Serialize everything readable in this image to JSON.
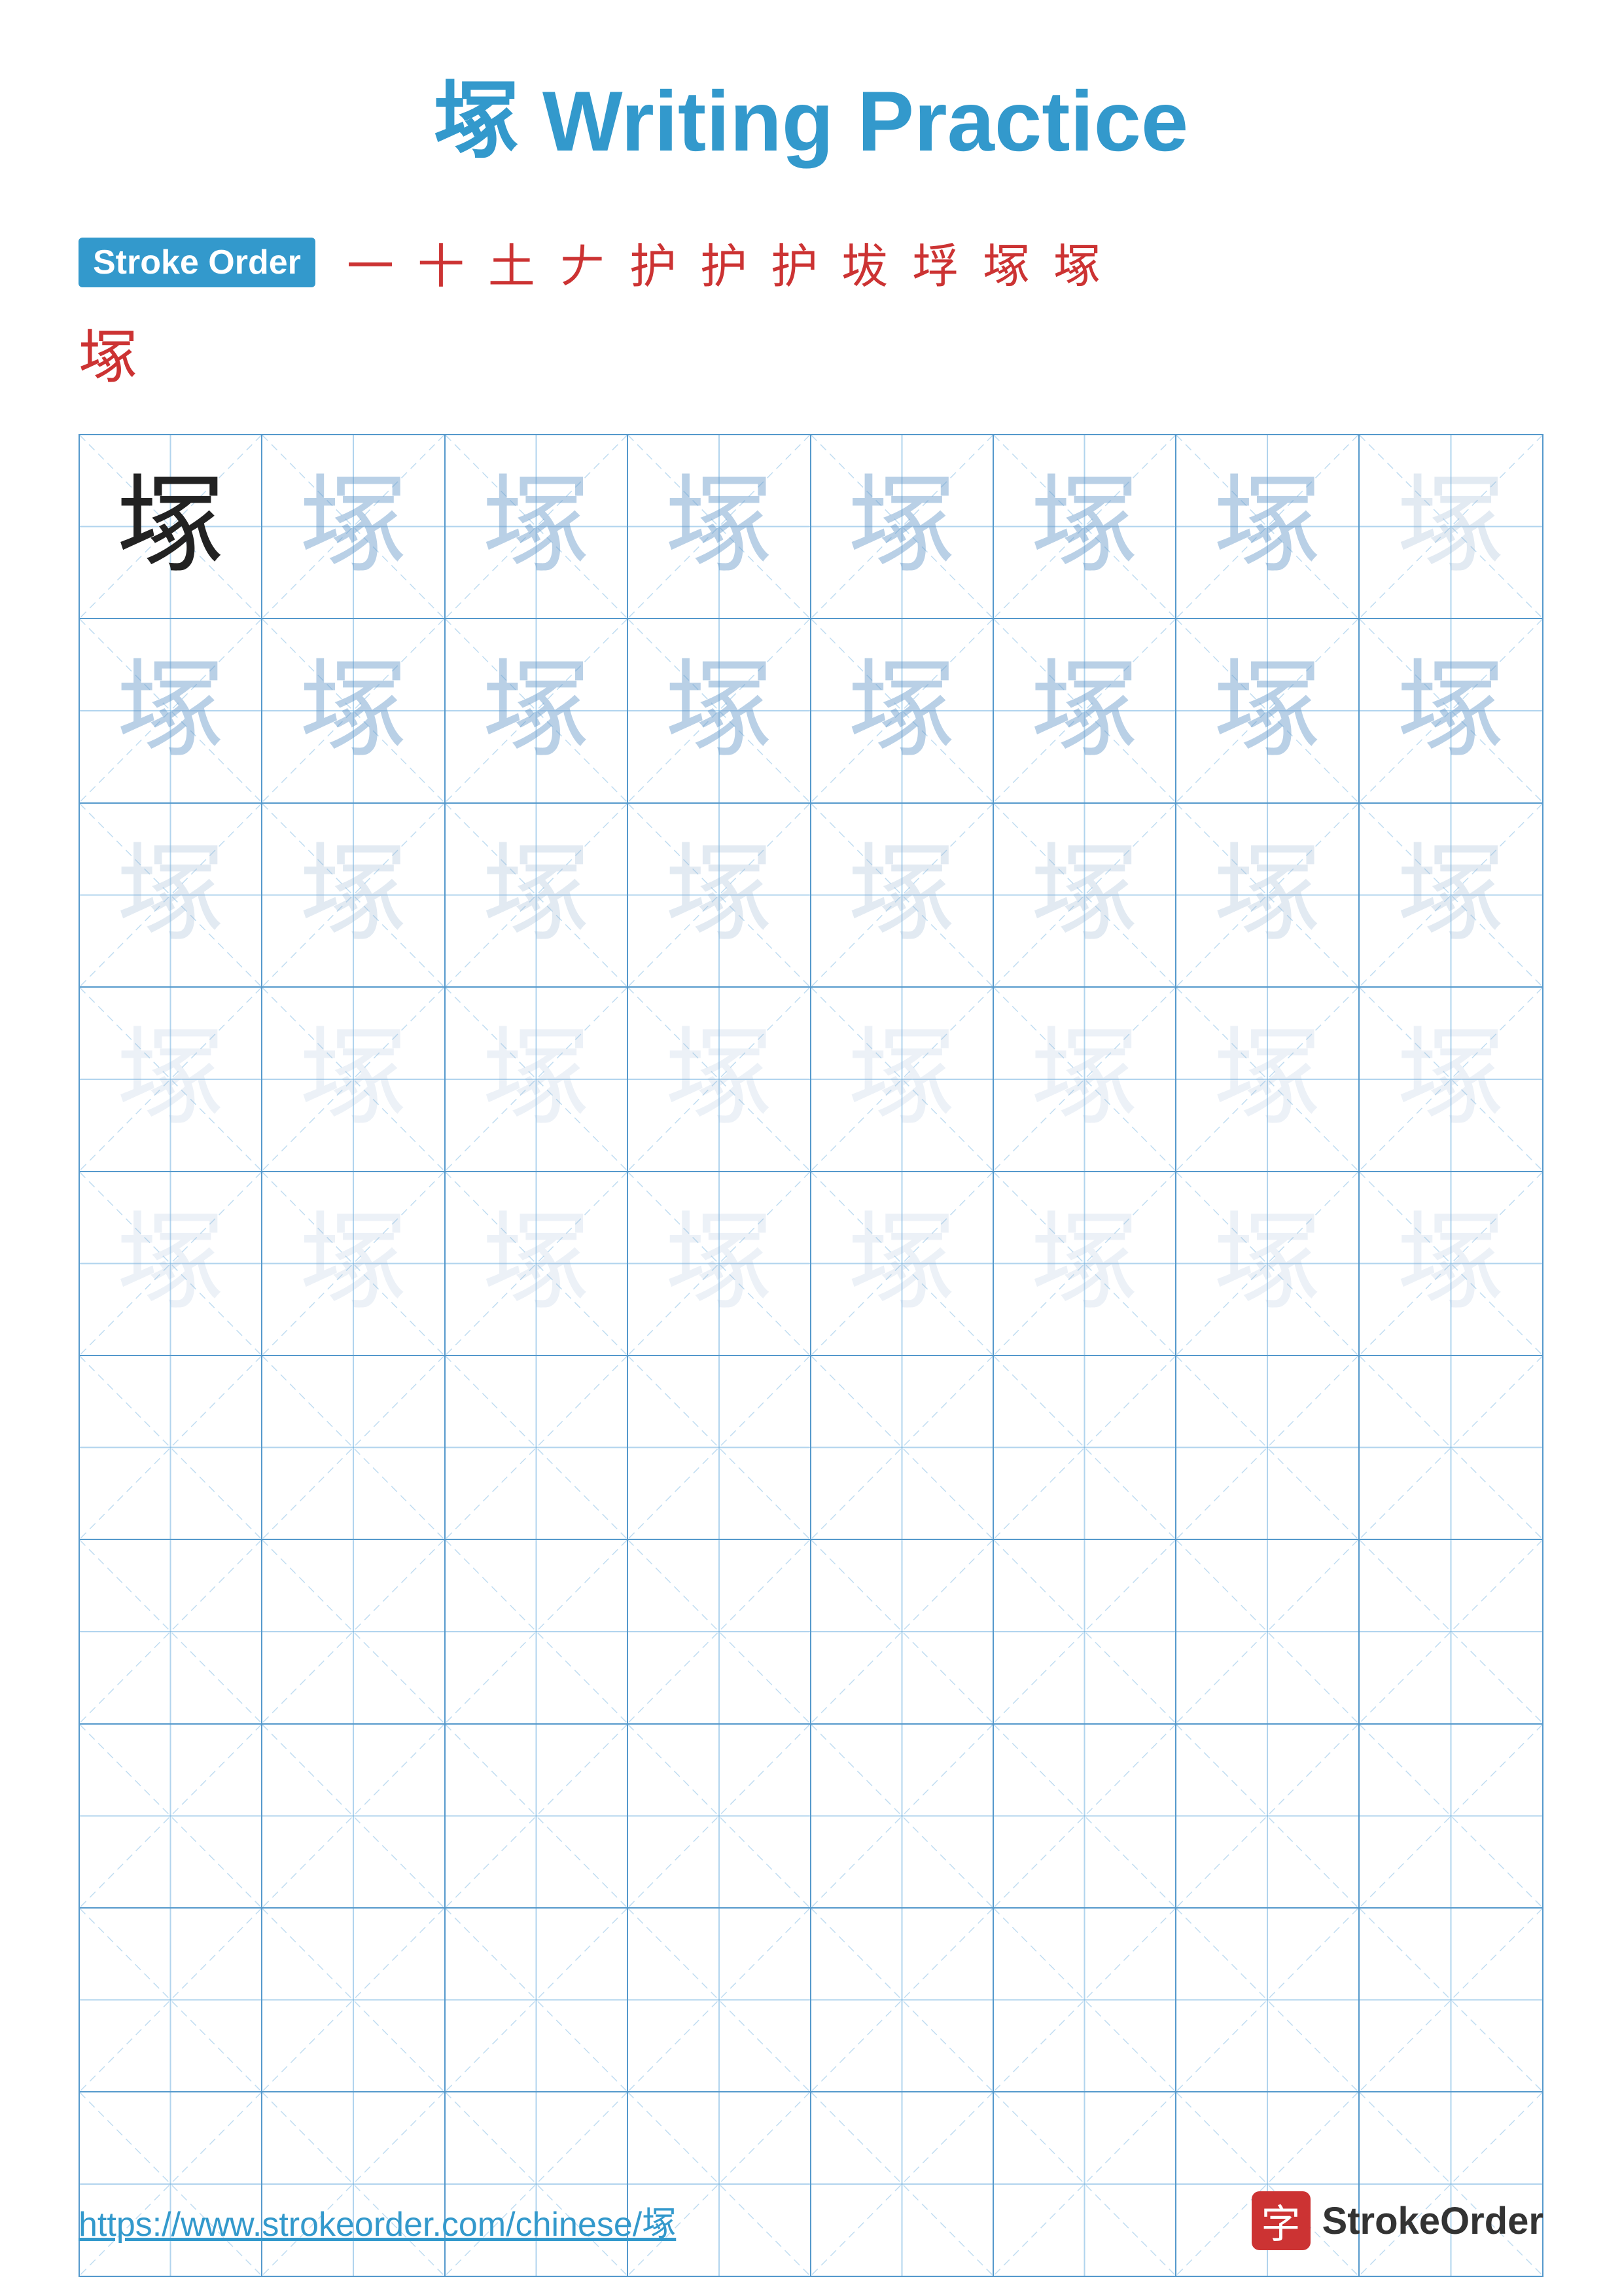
{
  "title": {
    "char": "塚",
    "text": " Writing Practice"
  },
  "stroke_order": {
    "badge_label": "Stroke Order",
    "strokes": [
      "一",
      "十",
      "土",
      "𠂇",
      "护",
      "护",
      "护",
      "坺",
      "垺",
      "塚",
      "塚"
    ],
    "final_char": "塚"
  },
  "grid": {
    "rows": 10,
    "cols": 8,
    "char": "塚",
    "filled_rows": 5
  },
  "footer": {
    "url": "https://www.strokeorder.com/chinese/塚",
    "logo_char": "字",
    "logo_text": "StrokeOrder"
  }
}
